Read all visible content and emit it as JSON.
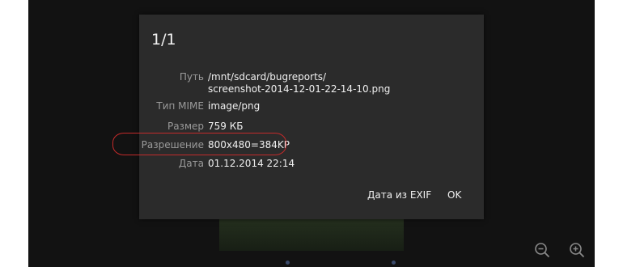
{
  "dialog": {
    "title": "1/1",
    "fields": [
      {
        "label": "Путь",
        "value_lines": [
          "/mnt/sdcard/bugreports/",
          "screenshot-2014-12-01-22-14-10.png"
        ]
      },
      {
        "label": "Тип MIME",
        "value": "image/png"
      },
      {
        "label": "Размер",
        "value": "759 КБ"
      },
      {
        "label": "Разрешение",
        "value": "800x480=384KP"
      },
      {
        "label": "Дата",
        "value": "01.12.2014 22:14"
      }
    ],
    "buttons": {
      "exif": "Дата из EXIF",
      "ok": "OK"
    }
  },
  "toolbar": {
    "icons": [
      "zoom-out-icon",
      "zoom-in-icon"
    ]
  },
  "colors": {
    "highlight": "#c22a2a",
    "dialog_bg": "#2b2b2b",
    "screen_bg": "#121212"
  }
}
